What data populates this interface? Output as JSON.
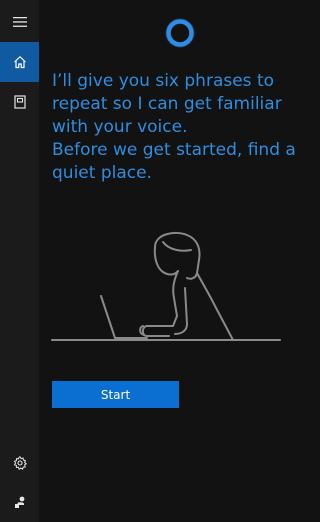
{
  "sidebar": {
    "items": [
      {
        "name": "menu",
        "icon": "hamburger-menu-icon"
      },
      {
        "name": "home",
        "icon": "home-icon",
        "active": true
      },
      {
        "name": "notebook",
        "icon": "notebook-icon"
      },
      {
        "name": "settings",
        "icon": "gear-icon"
      },
      {
        "name": "feedback",
        "icon": "feedback-icon"
      }
    ]
  },
  "main": {
    "message_line1": "I’ll give you six phrases to repeat so I can get familiar with your voice.",
    "message_line2": "Before we get started, find a quiet place.",
    "start_label": "Start"
  },
  "colors": {
    "accent": "#0a6fd1",
    "text_accent": "#2d8ee0",
    "sidebar_active": "#0f5aa0",
    "background": "#121212",
    "sidebar_bg": "#1b1b1b"
  }
}
